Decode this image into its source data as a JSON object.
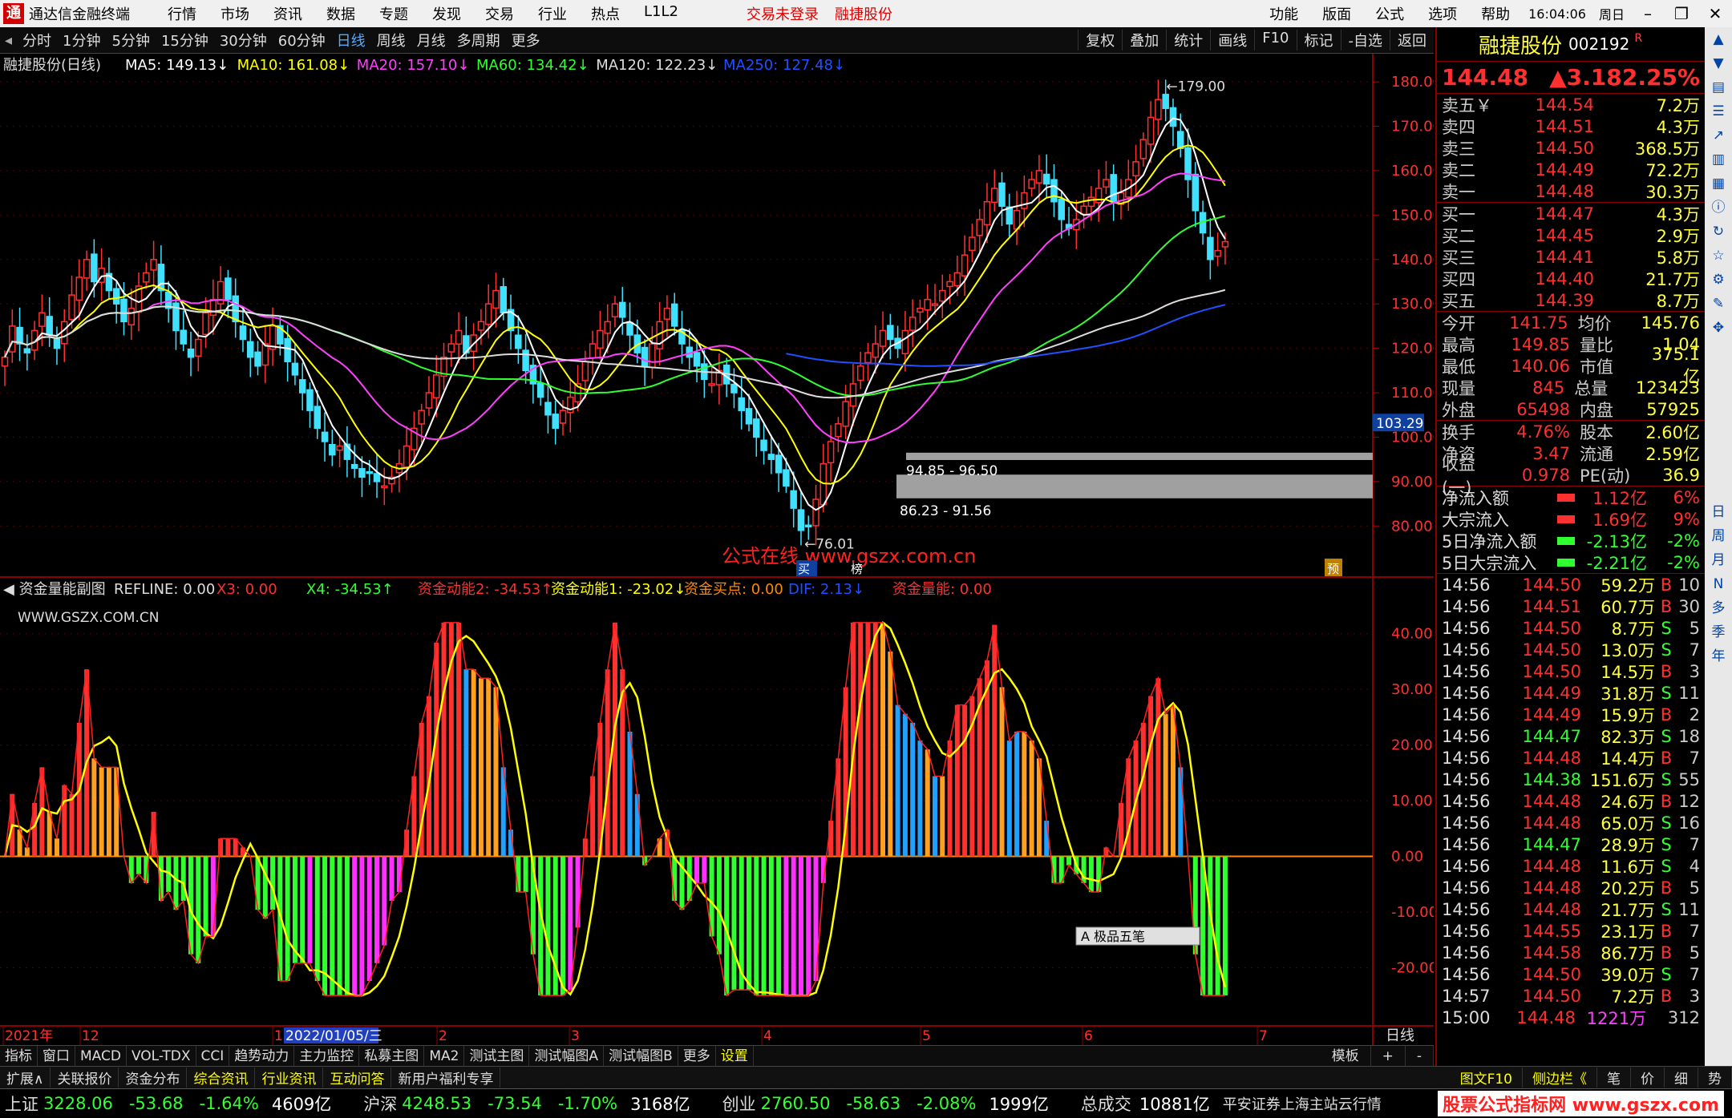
{
  "app": {
    "title": "通达信金融终端",
    "logo_text": "通",
    "menus": [
      "行情",
      "市场",
      "资讯",
      "数据",
      "专题",
      "发现",
      "交易",
      "行业",
      "热点",
      "L1L2"
    ],
    "login_status": "交易未登录",
    "stock_link": "融捷股份",
    "right_menus": [
      "功能",
      "版面",
      "公式",
      "选项",
      "帮助"
    ],
    "clock": "16:04:06",
    "weekday": "周日"
  },
  "periods": {
    "items": [
      "分时",
      "1分钟",
      "5分钟",
      "15分钟",
      "30分钟",
      "60分钟",
      "日线",
      "周线",
      "月线",
      "多周期",
      "更多"
    ],
    "active": "日线",
    "tools": [
      "复权",
      "叠加",
      "统计",
      "画线",
      "F10",
      "标记",
      "-自选",
      "返回"
    ]
  },
  "main_legend": {
    "name": "融捷股份(日线)",
    "ma": [
      {
        "t": "MA5: 149.13",
        "c": "#ffffff"
      },
      {
        "t": "MA10: 161.08",
        "c": "#ffff00"
      },
      {
        "t": "MA20: 157.10",
        "c": "#ff40ff"
      },
      {
        "t": "MA60: 134.42",
        "c": "#30ff30"
      },
      {
        "t": "MA120: 122.23",
        "c": "#dddddd"
      },
      {
        "t": "MA250: 127.48",
        "c": "#2050ff"
      }
    ]
  },
  "price_axis": [
    "180.00",
    "170.00",
    "160.00",
    "150.00",
    "140.00",
    "130.00",
    "120.00",
    "110.00",
    "100.00",
    "90.00",
    "80.00"
  ],
  "cur_price_tag": "103.29",
  "annotations": {
    "high": "179.00",
    "low": "76.01",
    "zone1": "94.85 - 96.50",
    "zone2": "86.23 - 91.56",
    "watermark": "公式在线  www.gszx.com.cn",
    "tag_buy": "买",
    "tag_rong": "榜",
    "tag_yu": "预"
  },
  "sub_legend": {
    "title": "资金量能副图",
    "refline": "REFLINE: 0.00",
    "items": [
      {
        "t": "X3: 0.00",
        "c": "#ff3030"
      },
      {
        "t": "X4: -34.53↑",
        "c": "#30ff30"
      },
      {
        "t": "资金动能2: -34.53↑",
        "c": "#ff3030"
      },
      {
        "t": "资金动能1: -23.02↓",
        "c": "#ffff00"
      },
      {
        "t": "资金买点: 0.00",
        "c": "#ff8800"
      },
      {
        "t": "DIF: 2.13↓",
        "c": "#2050ff"
      },
      {
        "t": "资金量能: 0.00",
        "c": "#ff3030"
      }
    ],
    "site": "WWW.GSZX.COM.CN"
  },
  "sub_axis": [
    "40.00",
    "30.00",
    "20.00",
    "10.00",
    "0.00",
    "-10.00",
    "-20.00"
  ],
  "date_axis": [
    {
      "t": "2021年",
      "x": 4
    },
    {
      "t": "12",
      "x": 100
    },
    {
      "t": "1",
      "x": 340
    },
    {
      "t": "2022/01/05/三",
      "x": 354
    },
    {
      "t": "2",
      "x": 545
    },
    {
      "t": "3",
      "x": 710
    },
    {
      "t": "4",
      "x": 950
    },
    {
      "t": "5",
      "x": 1148
    },
    {
      "t": "6",
      "x": 1350
    },
    {
      "t": "7",
      "x": 1568
    }
  ],
  "date_right": "日线",
  "ime_box": "A 极品五笔",
  "tabs": [
    "指标",
    "窗口",
    "MACD",
    "VOL-TDX",
    "CCI",
    "趋势动力",
    "主力监控",
    "私募主图",
    "MA2",
    "测试主图",
    "测试幅图A",
    "测试幅图B",
    "更多",
    "设置"
  ],
  "tab_right": [
    "模板",
    "+",
    "-"
  ],
  "info_items": [
    "扩展∧",
    "关联报价",
    "资金分布",
    "综合资讯",
    "行业资讯",
    "互动问答",
    "新用户福利专享"
  ],
  "info_right": [
    "图文F10",
    "侧边栏《",
    "笔",
    "价",
    "细",
    "势"
  ],
  "quote": {
    "name": "融捷股份",
    "code": "002192",
    "mark": "R",
    "price": "144.48",
    "change": "▲3.18",
    "pct": "2.25%",
    "asks": [
      [
        "卖五￥",
        "144.54",
        "7.2万"
      ],
      [
        "卖四",
        "144.51",
        "4.3万"
      ],
      [
        "卖三",
        "144.50",
        "368.5万"
      ],
      [
        "卖二",
        "144.49",
        "72.2万"
      ],
      [
        "卖一",
        "144.48",
        "30.3万"
      ]
    ],
    "bids": [
      [
        "买一",
        "144.47",
        "4.3万"
      ],
      [
        "买二",
        "144.45",
        "2.9万"
      ],
      [
        "买三",
        "144.41",
        "5.8万"
      ],
      [
        "买四",
        "144.40",
        "21.7万"
      ],
      [
        "买五",
        "144.39",
        "8.7万"
      ]
    ],
    "stats": [
      [
        "今开",
        "141.75",
        "均价",
        "145.76"
      ],
      [
        "最高",
        "149.85",
        "量比",
        "1.04"
      ],
      [
        "最低",
        "140.06",
        "市值",
        "375.1亿"
      ],
      [
        "现量",
        "845",
        "总量",
        "123423"
      ],
      [
        "外盘",
        "65498",
        "内盘",
        "57925"
      ]
    ],
    "stats2": [
      [
        "换手",
        "4.76%",
        "股本",
        "2.60亿"
      ],
      [
        "净资",
        "3.47",
        "流通",
        "2.59亿"
      ],
      [
        "收益(一)",
        "0.978",
        "PE(动)",
        "36.9"
      ]
    ],
    "flows": [
      [
        "净流入额",
        "1.12亿",
        "6%",
        "r"
      ],
      [
        "大宗流入",
        "1.69亿",
        "9%",
        "r"
      ],
      [
        "5日净流入额",
        "-2.13亿",
        "-2%",
        "g"
      ],
      [
        "5日大宗流入",
        "-2.21亿",
        "-2%",
        "g"
      ]
    ],
    "ticks": [
      [
        "14:56",
        "144.50",
        "59.2万",
        "B",
        "10"
      ],
      [
        "14:56",
        "144.51",
        "60.7万",
        "B",
        "30"
      ],
      [
        "14:56",
        "144.50",
        "8.7万",
        "S",
        "5"
      ],
      [
        "14:56",
        "144.50",
        "13.0万",
        "S",
        "7"
      ],
      [
        "14:56",
        "144.50",
        "14.5万",
        "B",
        "3"
      ],
      [
        "14:56",
        "144.49",
        "31.8万",
        "S",
        "11"
      ],
      [
        "14:56",
        "144.49",
        "15.9万",
        "B",
        "2"
      ],
      [
        "14:56",
        "144.47",
        "82.3万",
        "S",
        "18"
      ],
      [
        "14:56",
        "144.48",
        "14.4万",
        "B",
        "7"
      ],
      [
        "14:56",
        "144.38",
        "151.6万",
        "S",
        "55"
      ],
      [
        "14:56",
        "144.48",
        "24.6万",
        "B",
        "12"
      ],
      [
        "14:56",
        "144.48",
        "65.0万",
        "S",
        "16"
      ],
      [
        "14:56",
        "144.47",
        "28.9万",
        "S",
        "7"
      ],
      [
        "14:56",
        "144.48",
        "11.6万",
        "S",
        "4"
      ],
      [
        "14:56",
        "144.48",
        "20.2万",
        "B",
        "5"
      ],
      [
        "14:56",
        "144.48",
        "21.7万",
        "S",
        "11"
      ],
      [
        "14:56",
        "144.55",
        "23.1万",
        "B",
        "7"
      ],
      [
        "14:56",
        "144.58",
        "86.7万",
        "B",
        "5"
      ],
      [
        "14:56",
        "144.50",
        "39.0万",
        "S",
        "7"
      ],
      [
        "14:57",
        "144.50",
        "7.2万",
        "B",
        "3"
      ],
      [
        "15:00",
        "144.48",
        "1221万",
        "",
        "312"
      ]
    ]
  },
  "side_tools": [
    "日",
    "周",
    "月",
    "N",
    "多",
    "季",
    "年"
  ],
  "status": {
    "items": [
      [
        "上证",
        "3228.06",
        "-53.68",
        "-1.64%",
        "4609亿"
      ],
      [
        "沪深",
        "4248.53",
        "-73.54",
        "-1.70%",
        "3168亿"
      ],
      [
        "创业",
        "2760.50",
        "-58.63",
        "-2.08%",
        "1999亿"
      ]
    ],
    "total_label": "总成交",
    "total": "10881亿",
    "broker": "平安证券上海主站云行情",
    "site": "股票公式指标网 www.gszx.com"
  },
  "chart_data": {
    "type": "candlestick",
    "y_range": [
      75,
      182
    ],
    "sub_range": [
      -27,
      45
    ],
    "closes": [
      118,
      125,
      121,
      119,
      124,
      128,
      123,
      120,
      126,
      132,
      136,
      140,
      135,
      138,
      133,
      130,
      126,
      129,
      134,
      137,
      140,
      133,
      129,
      124,
      121,
      118,
      122,
      128,
      131,
      135,
      131,
      126,
      122,
      118,
      116,
      121,
      125,
      121,
      117,
      114,
      110,
      106,
      102,
      99,
      96,
      98,
      95,
      93,
      91,
      92,
      90,
      89,
      91,
      94,
      98,
      102,
      106,
      110,
      114,
      118,
      121,
      124,
      119,
      123,
      126,
      130,
      133,
      128,
      124,
      120,
      115,
      112,
      109,
      105,
      102,
      106,
      109,
      112,
      117,
      121,
      124,
      126,
      130,
      127,
      123,
      119,
      116,
      121,
      126,
      129,
      125,
      121,
      118,
      116,
      113,
      112,
      115,
      112,
      110,
      106,
      103,
      100,
      97,
      95,
      92,
      89,
      84,
      79,
      80,
      86,
      94,
      99,
      103,
      108,
      112,
      116,
      119,
      121,
      124,
      122,
      120,
      124,
      127,
      129,
      131,
      130,
      133,
      135,
      137,
      141,
      145,
      149,
      153,
      156,
      152,
      148,
      151,
      155,
      158,
      160,
      157,
      153,
      149,
      147,
      149,
      152,
      154,
      156,
      158,
      153,
      155,
      158,
      162,
      167,
      172,
      176,
      174,
      170,
      165,
      158,
      151,
      146,
      140,
      142,
      144
    ]
  }
}
